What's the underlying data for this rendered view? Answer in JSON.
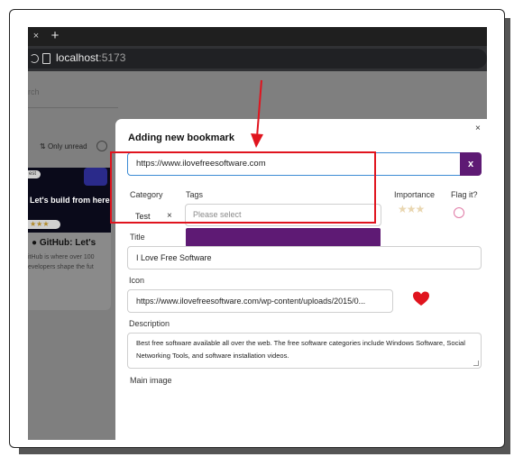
{
  "browser": {
    "tab_close_symbol": "×",
    "new_tab_symbol": "+",
    "address_host": "localhost",
    "address_port": ":5173"
  },
  "background": {
    "search_placeholder": "rch",
    "sort_label": "Only unread",
    "card": {
      "badge": "est",
      "image_text": "Let's build from here",
      "stars": "★★★",
      "title": "GitHub: Let's",
      "description_lines": [
        "itHub is where over 100",
        "evelopers shape the fut"
      ]
    }
  },
  "modal": {
    "title": "Adding new bookmark",
    "close_symbol": "×",
    "url_value": "https://www.ilovefreesoftware.com",
    "url_clear_label": "x",
    "category_label": "Category",
    "category_value": "Test",
    "category_clear_symbol": "×",
    "tags_label": "Tags",
    "tags_placeholder": "Please select",
    "importance_label": "Importance",
    "importance_stars": "★★★",
    "importance_rating": 0,
    "flag_label": "Flag it?",
    "title_label": "Title",
    "title_value": "I Love Free Software",
    "icon_label": "Icon",
    "icon_value": "https://www.ilovefreesoftware.com/wp-content/uploads/2015/0...",
    "description_label": "Description",
    "description_value": "Best free software available all over the web. The free software categories include Windows Software, Social Networking Tools, and software installation videos.",
    "main_image_label": "Main image"
  },
  "colors": {
    "accent_purple": "#5e1a74",
    "annotation_red": "#e0141e",
    "heart_red": "#e0141e",
    "focus_blue": "#3c8bd4"
  },
  "icons": {
    "url_clear": "close-icon",
    "heart": "heart-icon",
    "flag": "circle-checkbox-icon"
  }
}
